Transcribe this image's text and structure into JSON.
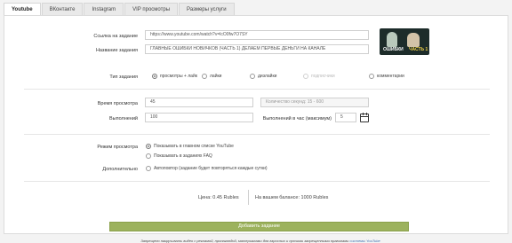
{
  "tabs": [
    {
      "label": "Youtube"
    },
    {
      "label": "ВКонтакте"
    },
    {
      "label": "Instagram"
    },
    {
      "label": "VIP просмотры"
    },
    {
      "label": "Размеры услуги"
    }
  ],
  "form": {
    "video_url_label": "Ссылка на задание",
    "video_url_value": "https://www.youtube.com/watch?v=lcO0fw7O7SY",
    "task_name_label": "Название задания",
    "task_name_value": "ГЛАВНЫЕ ОШИБКИ НОВИЧКОВ (ЧАСТЬ 1) ДЕЛАЕМ ПЕРВЫЕ ДЕНЬГИ НА КАНАЛЕ",
    "thumb_text_left": "ОШИБКИ",
    "thumb_text_right": "ЧАСТЬ 1",
    "task_type_label": "Тип задания",
    "task_types": [
      {
        "label": "просмотры + лайк",
        "state": "on"
      },
      {
        "label": "лайки",
        "state": "off"
      },
      {
        "label": "дизлайки",
        "state": "off"
      },
      {
        "label": "подписчики",
        "state": "dim"
      },
      {
        "label": "комментарии",
        "state": "off"
      }
    ],
    "view_time_label": "Время просмотра",
    "view_time_value": "45",
    "view_time_hint": "Количество секунд: 15 - 600",
    "executions_label": "Выполнений",
    "executions_value": "100",
    "per_hour_label": "Выполнений в час (максимум)",
    "per_hour_value": "5",
    "view_mode_label": "Режим просмотра",
    "view_modes": [
      {
        "label": "Показывать в главном списке YouTube",
        "state": "on"
      },
      {
        "label": "Показывать в заданиях FAQ",
        "state": "off"
      }
    ],
    "extra_label": "Дополнительно",
    "extra_options": [
      {
        "label": "Автоповтор (задание будет повторяться каждые сутки)",
        "state": "off"
      }
    ],
    "price_text": "Цена: 0.45 Rubles",
    "balance_text": "На вашем балансе: 1000 Rubles",
    "submit_label": "Добавить задание",
    "note_text": "Запрещено накручивать видео с рекламой, пропагандой, материалами для взрослых и прочими запрещенными правилами",
    "note_link": "системы YouTube"
  }
}
